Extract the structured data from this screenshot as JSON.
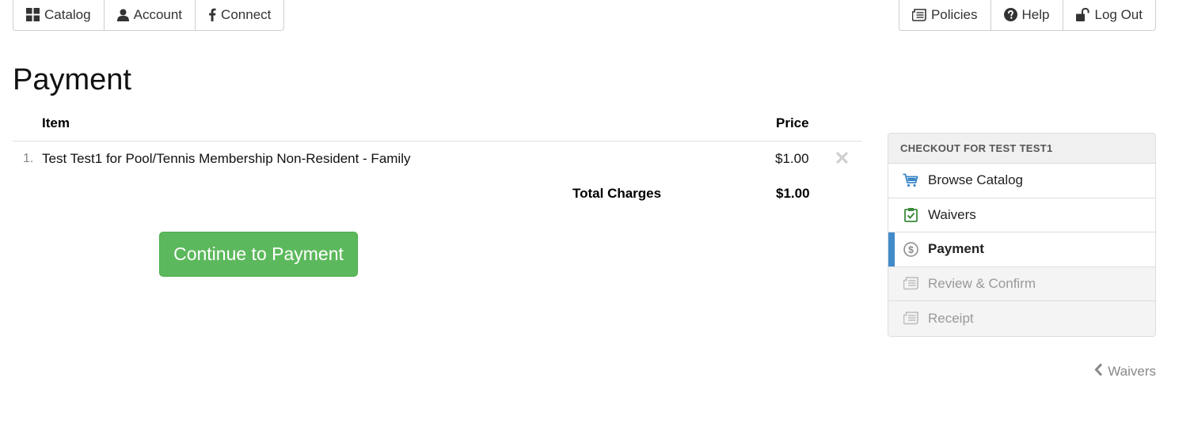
{
  "nav_left": [
    {
      "label": "Catalog",
      "icon": "grid-icon"
    },
    {
      "label": "Account",
      "icon": "user-icon"
    },
    {
      "label": "Connect",
      "icon": "facebook-icon"
    }
  ],
  "nav_right": [
    {
      "label": "Policies",
      "icon": "document-icon"
    },
    {
      "label": "Help",
      "icon": "question-icon"
    },
    {
      "label": "Log Out",
      "icon": "unlock-icon"
    }
  ],
  "page": {
    "title": "Payment"
  },
  "cart": {
    "columns": {
      "item": "Item",
      "price": "Price"
    },
    "rows": [
      {
        "num": "1.",
        "description": "Test Test1 for Pool/Tennis Membership Non-Resident - Family",
        "price": "$1.00"
      }
    ],
    "total_label": "Total Charges",
    "total_value": "$1.00"
  },
  "continue_button": "Continue to Payment",
  "checkout": {
    "title": "CHECKOUT FOR TEST TEST1",
    "steps": [
      {
        "label": "Browse Catalog",
        "icon": "cart-icon",
        "state": "done"
      },
      {
        "label": "Waivers",
        "icon": "clipboard-check-icon",
        "state": "done"
      },
      {
        "label": "Payment",
        "icon": "dollar-circle-icon",
        "state": "active"
      },
      {
        "label": "Review & Confirm",
        "icon": "document-icon",
        "state": "disabled"
      },
      {
        "label": "Receipt",
        "icon": "document-icon",
        "state": "disabled"
      }
    ]
  },
  "back_link": "Waivers",
  "colors": {
    "success": "#5cb85c",
    "active_bar": "#428bca",
    "cart_icon": "#3a87c8",
    "waiver_icon": "#3c8a3c"
  }
}
